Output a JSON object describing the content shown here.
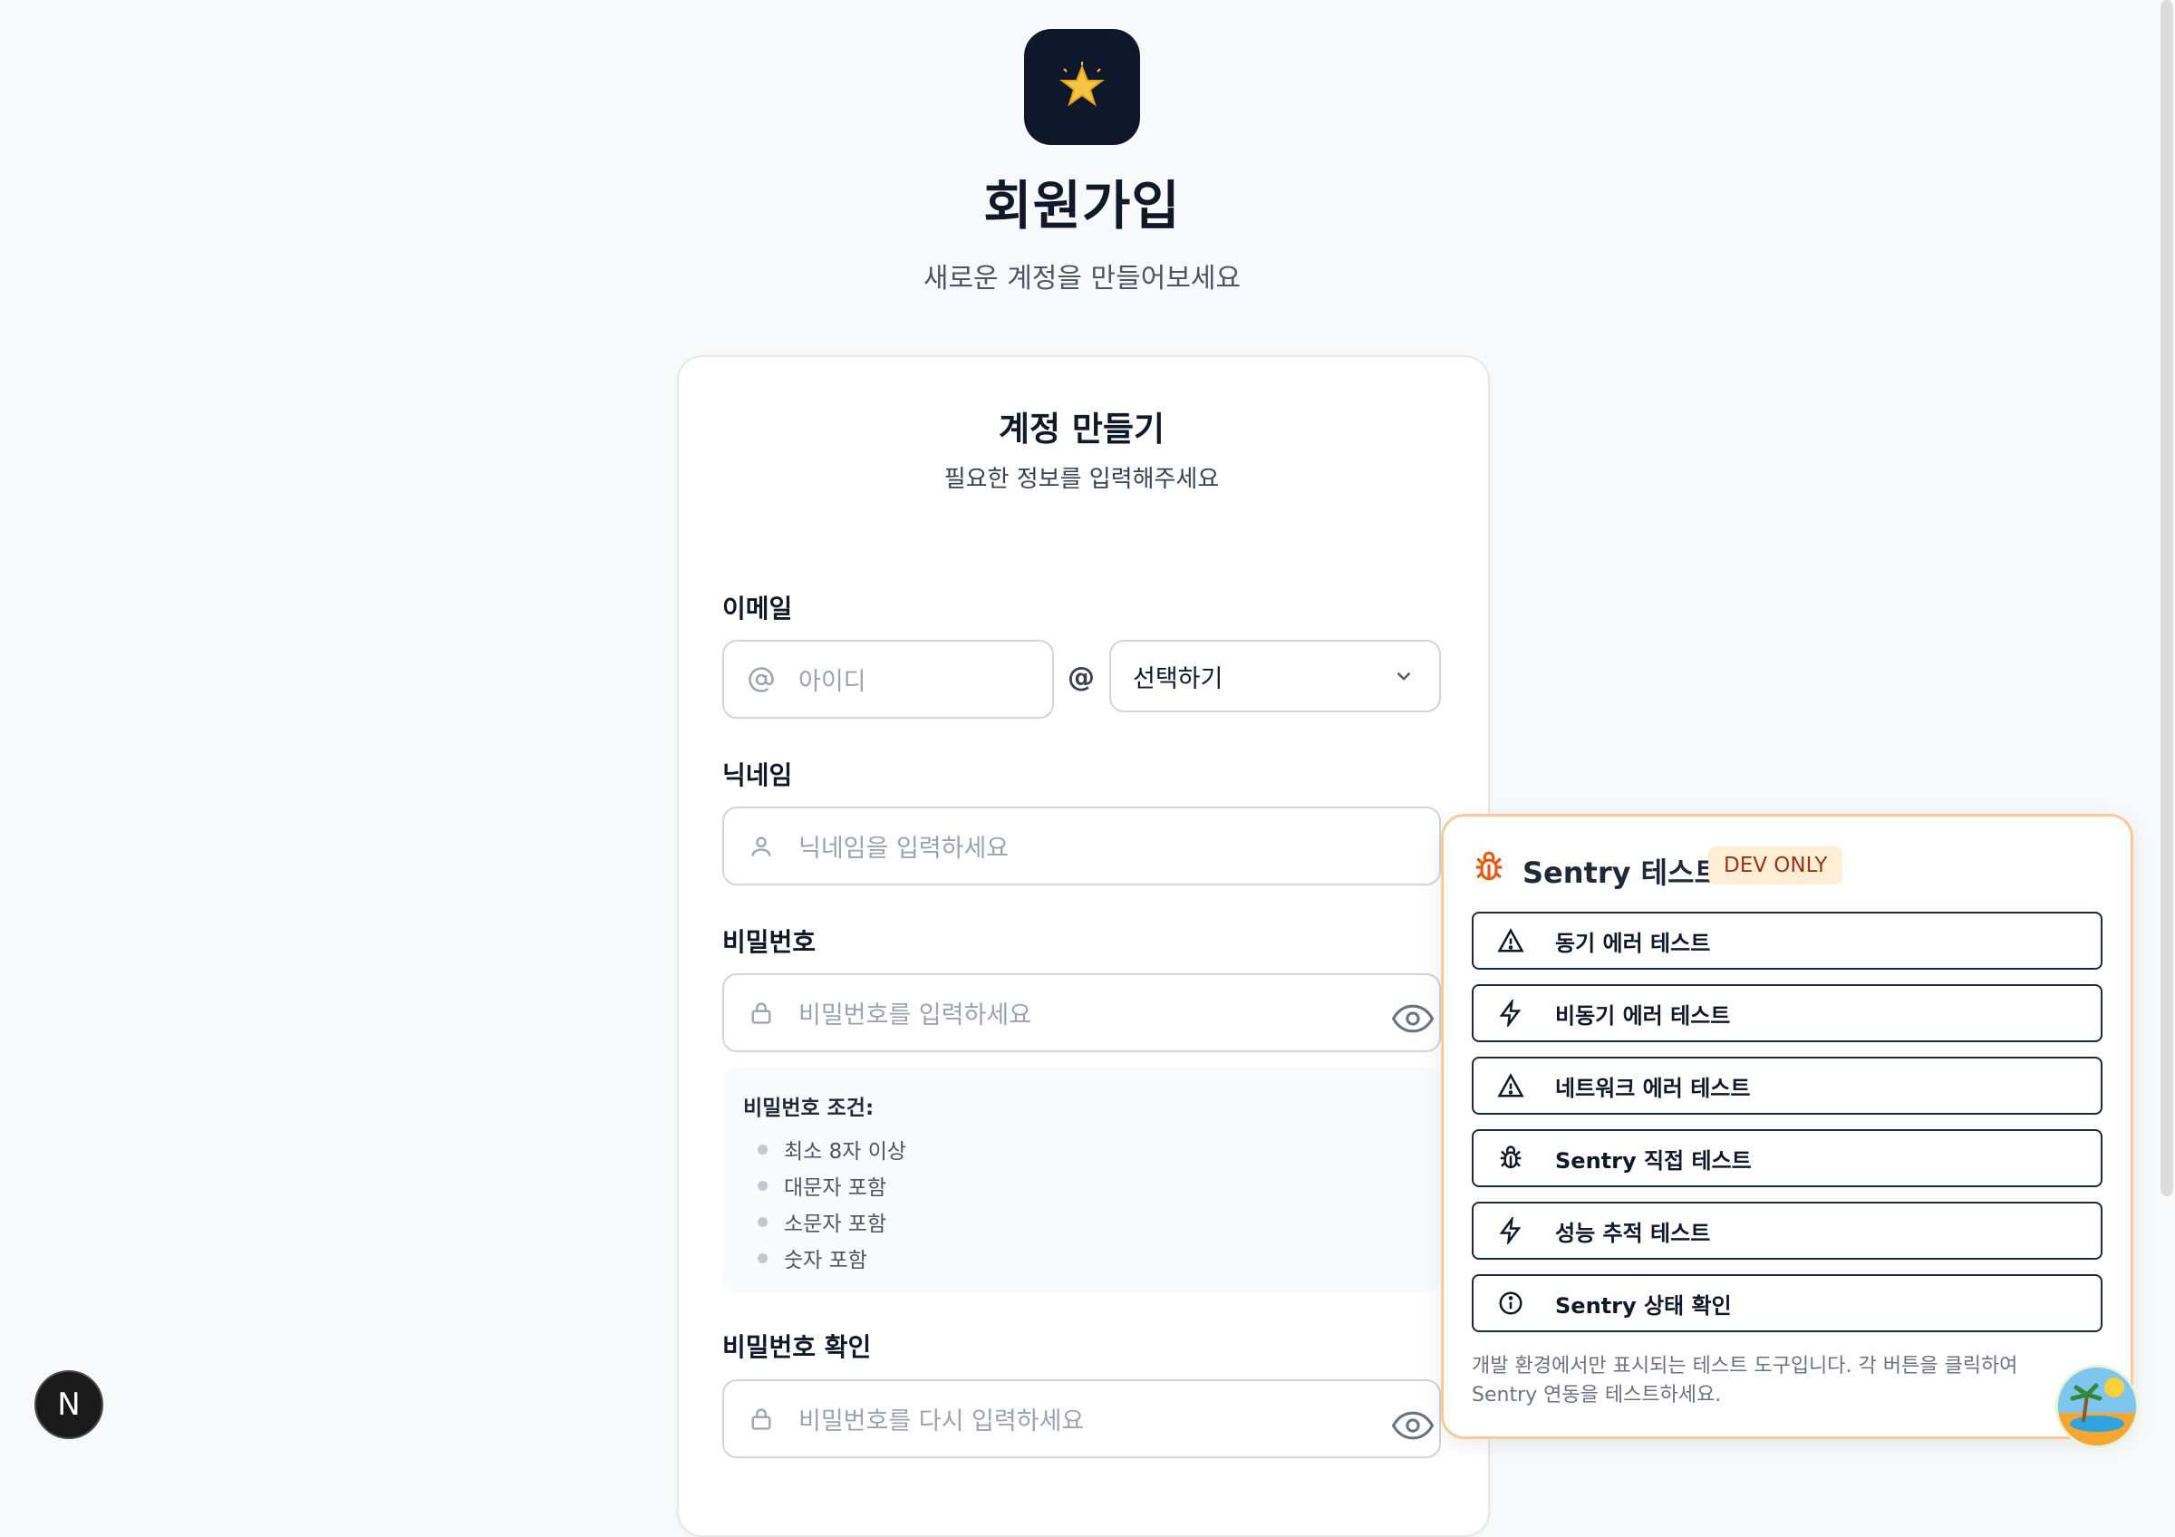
{
  "header": {
    "title": "회원가입",
    "subtitle": "새로운 계정을 만들어보세요"
  },
  "card": {
    "title": "계정 만들기",
    "subtitle": "필요한 정보를 입력해주세요"
  },
  "form": {
    "email_label": "이메일",
    "email_id_placeholder": "아이디",
    "at_symbol": "@",
    "domain_select_value": "선택하기",
    "nickname_label": "닉네임",
    "nickname_placeholder": "닉네임을 입력하세요",
    "password_label": "비밀번호",
    "password_placeholder": "비밀번호를 입력하세요",
    "password_rules_title": "비밀번호 조건:",
    "password_rules": [
      "최소 8자 이상",
      "대문자 포함",
      "소문자 포함",
      "숫자 포함"
    ],
    "password_confirm_label": "비밀번호 확인",
    "password_confirm_placeholder": "비밀번호를 다시 입력하세요"
  },
  "sentry": {
    "title": "Sentry 테스트",
    "badge": "DEV ONLY",
    "buttons": [
      {
        "label": "동기 에러 테스트",
        "icon": "alert-triangle-icon"
      },
      {
        "label": "비동기 에러 테스트",
        "icon": "lightning-icon"
      },
      {
        "label": "네트워크 에러 테스트",
        "icon": "alert-triangle-icon"
      },
      {
        "label": "Sentry 직접 테스트",
        "icon": "bug-icon"
      },
      {
        "label": "성능 추적 테스트",
        "icon": "lightning-icon"
      },
      {
        "label": "Sentry 상태 확인",
        "icon": "info-circle-icon"
      }
    ],
    "note": "개발 환경에서만 표시되는 테스트 도구입니다. 각 버튼을 클릭하여 Sentry 연동을 테스트하세요."
  },
  "devtools": {
    "next_badge": "N"
  },
  "colors": {
    "logo_bg": "#0f172a",
    "sentry_accent": "#ea580c",
    "sentry_border": "#fbc999",
    "badge_bg": "#ffedd5"
  }
}
